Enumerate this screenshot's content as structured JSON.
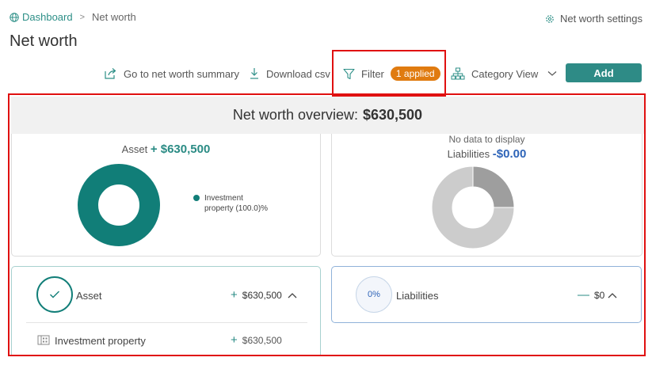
{
  "breadcrumb": {
    "home": "Dashboard",
    "separator": ">",
    "current": "Net worth"
  },
  "settings_label": "Net worth settings",
  "page_title": "Net worth",
  "toolbar": {
    "summary_label": "Go to net worth summary",
    "download_label": "Download csv",
    "filter_label": "Filter",
    "filter_badge": "1 applied",
    "category_label": "Category View",
    "add_label": "Add"
  },
  "overview": {
    "label": "Net worth overview:",
    "total": "$630,500"
  },
  "asset_chart": {
    "label": "Asset",
    "amount": "+ $630,500",
    "legend_line1": "Investment",
    "legend_line2": "property (100.0)%"
  },
  "liabilities_chart": {
    "no_data": "No data to display",
    "label": "Liabilities",
    "amount": "-$0.00"
  },
  "asset_panel": {
    "label": "Asset",
    "sign": "+",
    "amount": "$630,500",
    "sub_label": "Investment property",
    "sub_sign": "+",
    "sub_amount": "$630,500"
  },
  "liabilities_panel": {
    "percent": "0%",
    "label": "Liabilities",
    "sign": "—",
    "amount": "$0"
  },
  "chart_data": [
    {
      "type": "pie",
      "categories": [
        "Investment property"
      ],
      "values": [
        100.0
      ],
      "colors": [
        "#117e78"
      ]
    },
    {
      "type": "pie",
      "categories": [],
      "values": [
        25,
        75
      ],
      "colors": [
        "#9e9e9e",
        "#cccccc"
      ]
    }
  ],
  "colors": {
    "accent": "#2e8b86",
    "badge": "#e07b10",
    "highlight_border": "#e01010",
    "liabilities_blue": "#2e64b8"
  }
}
